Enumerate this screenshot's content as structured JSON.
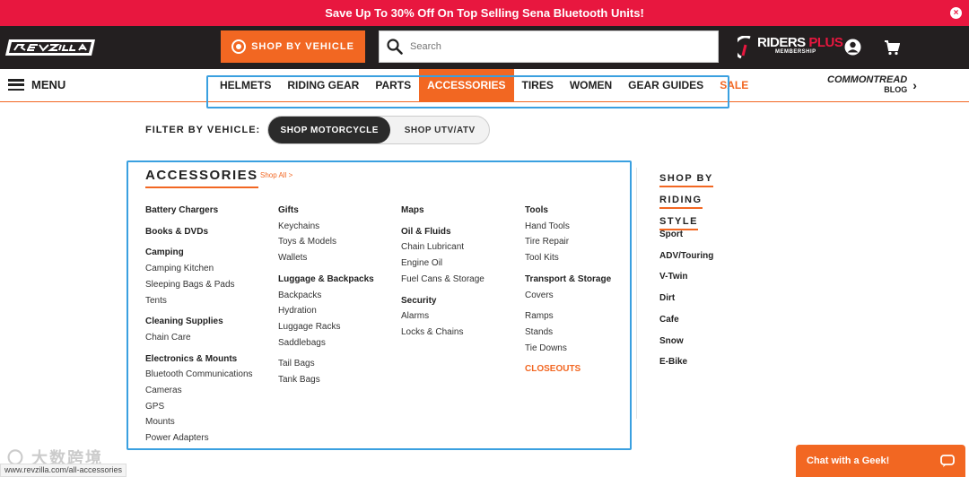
{
  "promo": {
    "text": "Save Up To 30% Off On Top Selling Sena Bluetooth Units!",
    "close": "×"
  },
  "header": {
    "shop_by_vehicle": "SHOP BY VEHICLE",
    "search_placeholder": "Search",
    "riders": "RIDERS",
    "plus": "PLUS",
    "membership": "MEMBERSHIP"
  },
  "nav": {
    "menu_label": "MENU",
    "items": [
      "HELMETS",
      "RIDING GEAR",
      "PARTS",
      "ACCESSORIES",
      "TIRES",
      "WOMEN",
      "GEAR GUIDES",
      "SALE"
    ],
    "active": "ACCESSORIES",
    "commontread": "COMMONTREAD",
    "blog": "BLOG"
  },
  "filter": {
    "label": "FILTER BY VEHICLE:",
    "option_on": "SHOP MOTORCYCLE",
    "option_off": "SHOP UTV/ATV"
  },
  "accessories": {
    "title": "ACCESSORIES",
    "shop_all": "Shop All >",
    "col1": [
      {
        "h": "Battery Chargers"
      },
      {
        "gap": true
      },
      {
        "h": "Books & DVDs"
      },
      {
        "gap": true
      },
      {
        "h": "Camping"
      },
      {
        "i": "Camping Kitchen"
      },
      {
        "i": "Sleeping Bags & Pads"
      },
      {
        "i": "Tents"
      },
      {
        "gap": true
      },
      {
        "h": "Cleaning Supplies"
      },
      {
        "i": "Chain Care"
      },
      {
        "gap": true
      },
      {
        "h": "Electronics & Mounts"
      },
      {
        "i": "Bluetooth Communications"
      },
      {
        "i": "Cameras"
      },
      {
        "i": "GPS"
      },
      {
        "i": "Mounts"
      },
      {
        "i": "Power Adapters"
      }
    ],
    "col2": [
      {
        "h": "Gifts"
      },
      {
        "i": "Keychains"
      },
      {
        "i": "Toys & Models"
      },
      {
        "i": "Wallets"
      },
      {
        "gap": true
      },
      {
        "h": "Luggage & Backpacks"
      },
      {
        "i": "Backpacks"
      },
      {
        "i": "Hydration"
      },
      {
        "i": "Luggage Racks"
      },
      {
        "i": "Saddlebags"
      },
      {
        "gap": true
      },
      {
        "i": "Tail Bags"
      },
      {
        "i": "Tank Bags"
      }
    ],
    "col3": [
      {
        "h": "Maps"
      },
      {
        "gap": true
      },
      {
        "h": "Oil & Fluids"
      },
      {
        "i": "Chain Lubricant"
      },
      {
        "i": "Engine Oil"
      },
      {
        "i": "Fuel Cans & Storage"
      },
      {
        "gap": true
      },
      {
        "h": "Security"
      },
      {
        "i": "Alarms"
      },
      {
        "i": "Locks & Chains"
      }
    ],
    "col4": [
      {
        "h": "Tools"
      },
      {
        "i": "Hand Tools"
      },
      {
        "i": "Tire Repair"
      },
      {
        "i": "Tool Kits"
      },
      {
        "gap": true
      },
      {
        "h": "Transport & Storage"
      },
      {
        "i": "Covers"
      },
      {
        "gap": true
      },
      {
        "i": "Ramps"
      },
      {
        "i": "Stands"
      },
      {
        "i": "Tie Downs"
      },
      {
        "gap": true
      },
      {
        "c": "CLOSEOUTS"
      }
    ]
  },
  "riding": {
    "title_line1": "SHOP BY RIDING",
    "title_line2": "STYLE",
    "items": [
      "Sport",
      "ADV/Touring",
      "V-Twin",
      "Dirt",
      "Cafe",
      "Snow",
      "E-Bike"
    ]
  },
  "chat": {
    "label": "Chat with a Geek!"
  },
  "status_url": "www.revzilla.com/all-accessories",
  "colors": {
    "promo": "#e8173f",
    "accent": "#f26722",
    "dark": "#231f20",
    "highlight": "#3aa0e0"
  }
}
